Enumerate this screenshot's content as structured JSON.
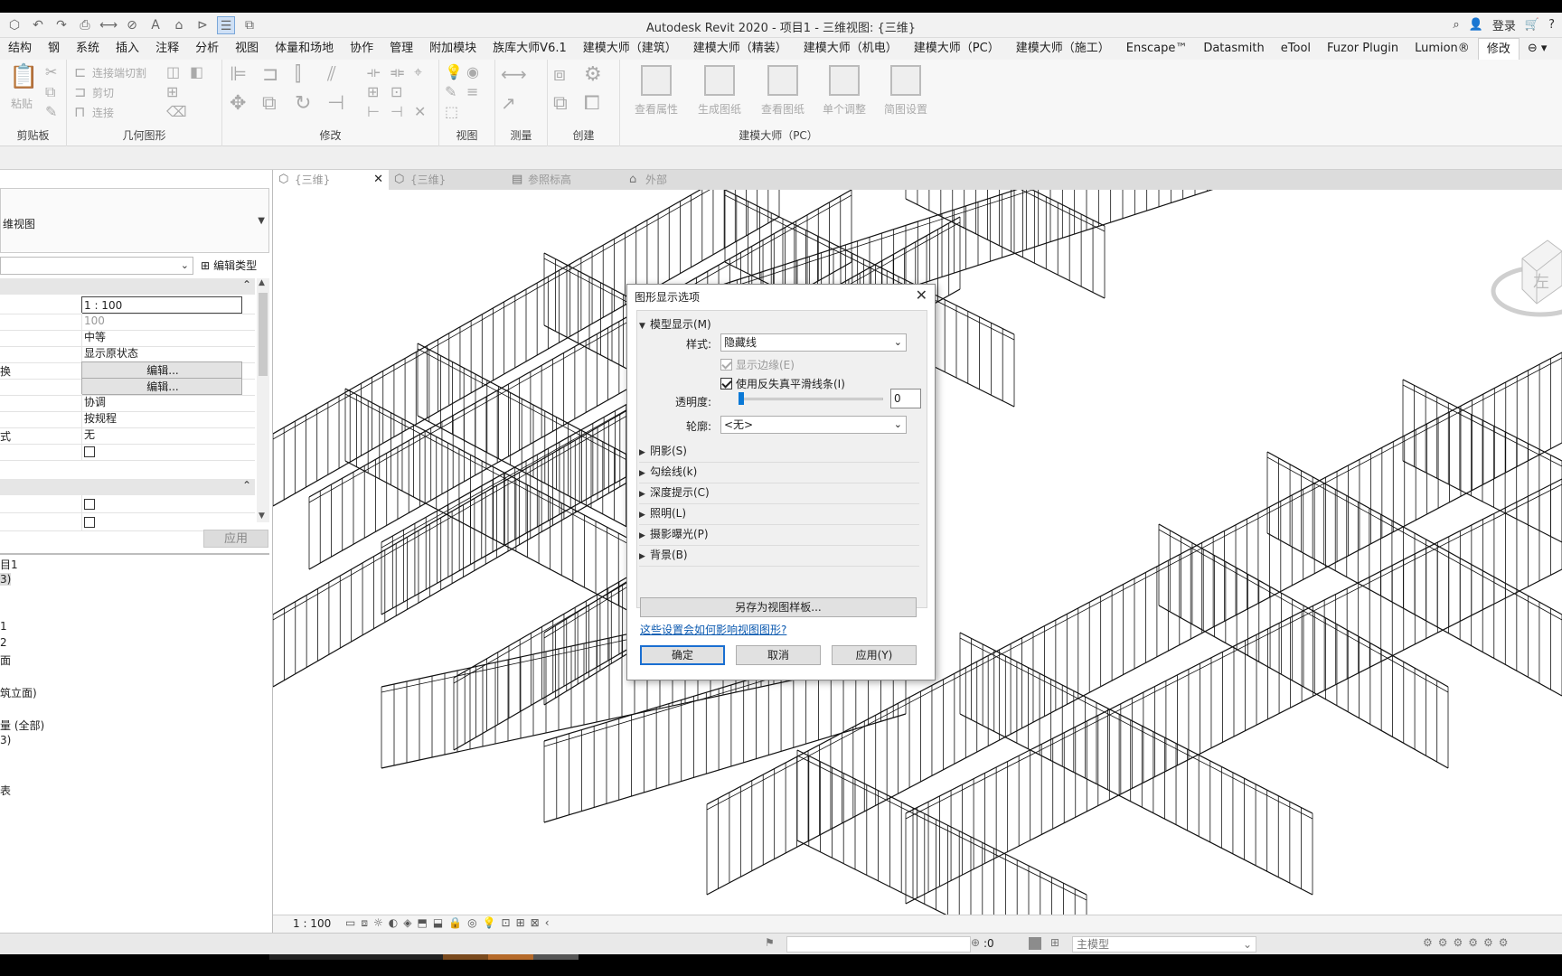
{
  "window": {
    "title": "Autodesk Revit 2020 - 项目1 - 三维视图: {三维}",
    "login_label": "登录",
    "help_label": "?"
  },
  "menu": {
    "tabs": [
      "结构",
      "钢",
      "系统",
      "插入",
      "注释",
      "分析",
      "视图",
      "体量和场地",
      "协作",
      "管理",
      "附加模块",
      "族库大师V6.1",
      "建模大师（建筑）",
      "建模大师（精装）",
      "建模大师（机电）",
      "建模大师（PC）",
      "建模大师（施工）",
      "Enscape™",
      "Datasmith",
      "eTool",
      "Fuzor Plugin",
      "Lumion®",
      "修改"
    ],
    "active_tab": "修改"
  },
  "ribbon": {
    "clipboard": {
      "label": "剪贴板",
      "paste": "粘贴"
    },
    "geometry": {
      "label": "几何图形",
      "cut_join": "连接端切割",
      "cut": "剪切",
      "join": "连接"
    },
    "modify": {
      "label": "修改"
    },
    "view": {
      "label": "视图"
    },
    "measure": {
      "label": "测量"
    },
    "create": {
      "label": "创建"
    },
    "pc": {
      "label": "建模大师（PC）",
      "buttons": [
        "查看属性",
        "生成图纸",
        "查看图纸",
        "单个调整",
        "简图设置"
      ]
    }
  },
  "properties": {
    "type_name": "维视图",
    "edit_type_label": "编辑类型",
    "rows": [
      {
        "name": "",
        "value": "1 : 100"
      },
      {
        "name": "",
        "value": "100"
      },
      {
        "name": "",
        "value": "中等"
      },
      {
        "name": "",
        "value": "显示原状态"
      },
      {
        "name": "换",
        "value": "编辑..."
      },
      {
        "name": "",
        "value": "编辑..."
      },
      {
        "name": "",
        "value": "协调"
      },
      {
        "name": "",
        "value": "按规程"
      },
      {
        "name": "式",
        "value": "无"
      }
    ],
    "apply_label": "应用"
  },
  "browser": {
    "items": [
      "目1",
      "3)",
      "1",
      "2",
      "面",
      "筑立面)",
      "量 (全部)",
      "3)",
      "表"
    ]
  },
  "view_tabs": [
    {
      "label": "{三维}",
      "active": true,
      "close": "✕"
    },
    {
      "label": "{三维}",
      "active": false
    },
    {
      "label": "参照标高",
      "active": false
    },
    {
      "label": "外部",
      "active": false
    }
  ],
  "view_control": {
    "scale": "1 : 100"
  },
  "viewcube": {
    "face_label": "左"
  },
  "statusbar": {
    "zero_value": ":0",
    "model_label": "主模型"
  },
  "dialog": {
    "title": "图形显示选项",
    "model_display": {
      "header": "模型显示(M)",
      "style_label": "样式:",
      "style_value": "隐藏线",
      "show_edges_label": "显示边缘(E)",
      "show_edges_checked": true,
      "antialias_label": "使用反失真平滑线条(I)",
      "antialias_checked": true,
      "transparency_label": "透明度:",
      "transparency_value": "0",
      "silhouette_label": "轮廓:",
      "silhouette_value": "<无>"
    },
    "sections": [
      "阴影(S)",
      "勾绘线(k)",
      "深度提示(C)",
      "照明(L)",
      "摄影曝光(P)",
      "背景(B)"
    ],
    "save_template_label": "另存为视图样板...",
    "help_link": "这些设置会如何影响视图图形?",
    "ok_label": "确定",
    "cancel_label": "取消",
    "apply_label": "应用(Y)"
  },
  "colors": {
    "accent": "#0a79d6",
    "selection_border": "#1a6fd1",
    "link": "#0c5ab0"
  }
}
